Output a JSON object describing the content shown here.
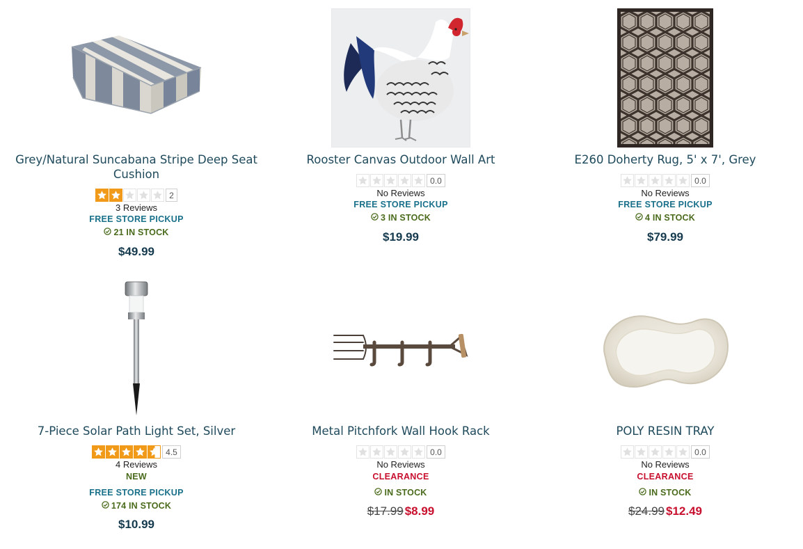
{
  "colors": {
    "title": "#1f4a5c",
    "pickup": "#19708a",
    "stock": "#4a6b1c",
    "star": "#f19a1a",
    "new": "#4a6b1c",
    "clearance": "#c8102e",
    "price": "#153a4e"
  },
  "products": [
    {
      "title_line1": "Grey/Natural Suncabana Stripe Deep Seat",
      "title_line2": "Cushion",
      "rating": 2,
      "rating_label": "2",
      "reviews": "3 Reviews",
      "pickup": "FREE STORE PICKUP",
      "stock": "21 IN STOCK",
      "price": "$49.99",
      "image_icon": "striped-cushion-image"
    },
    {
      "title": "Rooster Canvas Outdoor Wall Art",
      "rating": 0,
      "rating_label": "0.0",
      "reviews": "No Reviews",
      "pickup": "FREE STORE PICKUP",
      "stock": "3 IN STOCK",
      "price": "$19.99",
      "image_icon": "rooster-canvas-image"
    },
    {
      "title": "E260 Doherty Rug, 5' x 7', Grey",
      "rating": 0,
      "rating_label": "0.0",
      "reviews": "No Reviews",
      "pickup": "FREE STORE PICKUP",
      "stock": "4 IN STOCK",
      "price": "$79.99",
      "image_icon": "geometric-rug-image"
    },
    {
      "title": "7-Piece Solar Path Light Set, Silver",
      "rating": 4.5,
      "rating_label": "4.5",
      "reviews": "4 Reviews",
      "badge": "NEW",
      "pickup": "FREE STORE PICKUP",
      "stock": "174 IN STOCK",
      "price": "$10.99",
      "image_icon": "solar-path-light-image"
    },
    {
      "title": "Metal Pitchfork Wall Hook Rack",
      "rating": 0,
      "rating_label": "0.0",
      "reviews": "No Reviews",
      "badge": "CLEARANCE",
      "stock": "IN STOCK",
      "was_price": "$17.99",
      "sale_price": "$8.99",
      "image_icon": "pitchfork-hook-rack-image"
    },
    {
      "title": "POLY RESIN TRAY",
      "rating": 0,
      "rating_label": "0.0",
      "reviews": "No Reviews",
      "badge": "CLEARANCE",
      "stock": "IN STOCK",
      "was_price": "$24.99",
      "sale_price": "$12.49",
      "image_icon": "resin-tray-image"
    }
  ]
}
